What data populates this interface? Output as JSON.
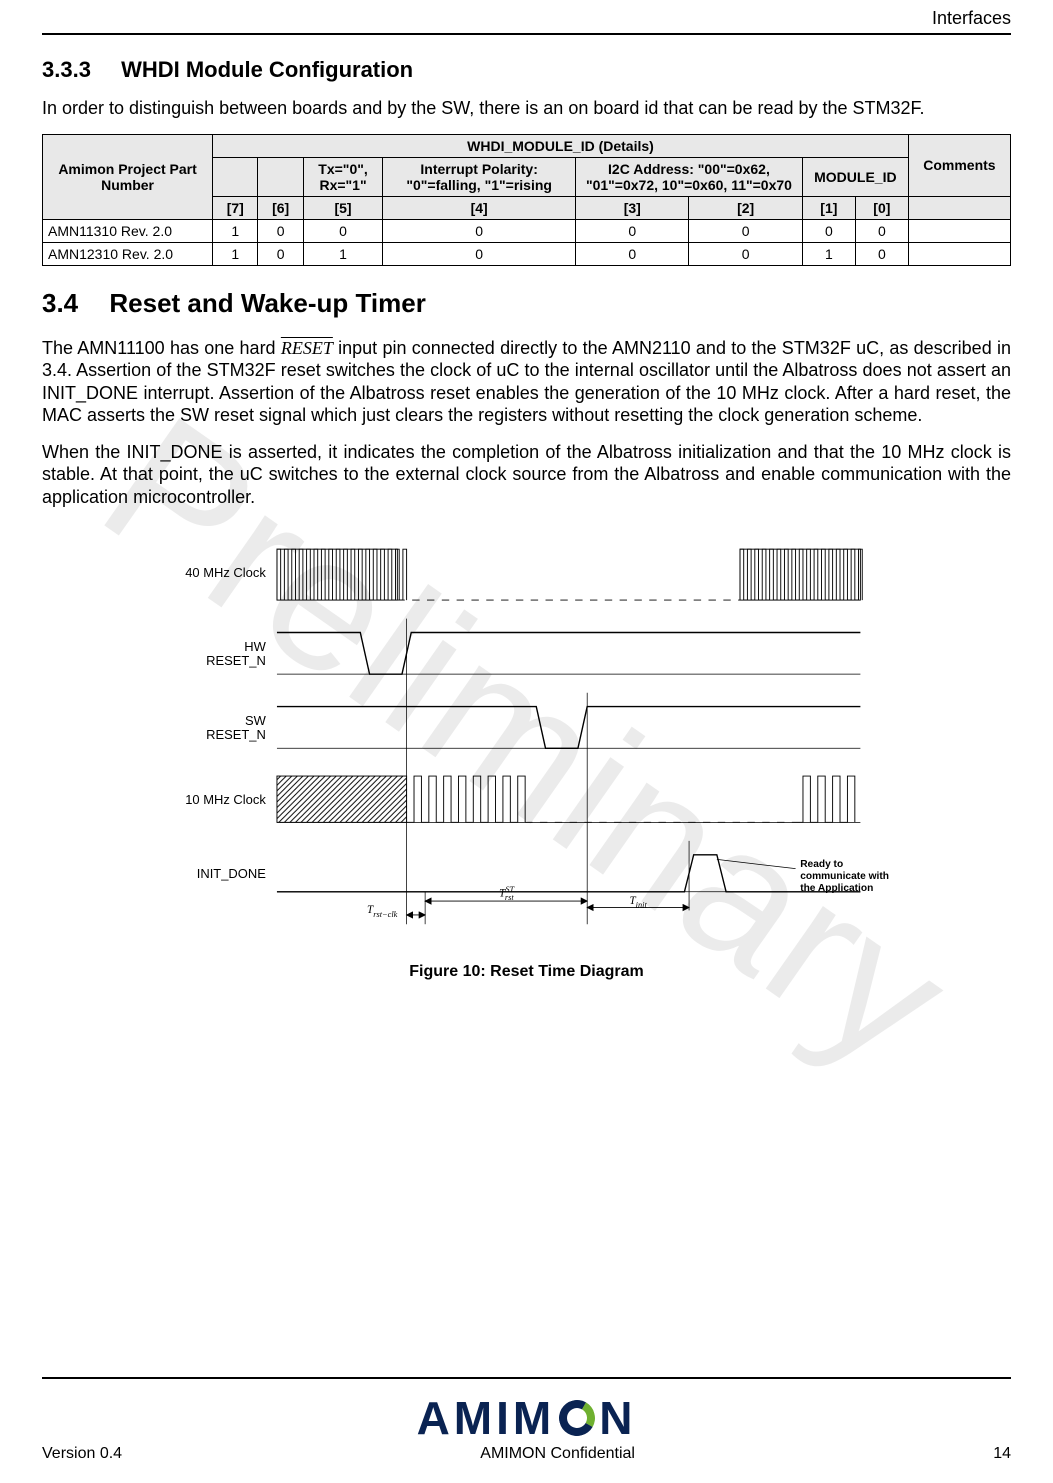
{
  "header": {
    "section": "Interfaces"
  },
  "s333": {
    "num": "3.3.3",
    "title": "WHDI Module Configuration",
    "intro": "In order to distinguish between boards and by the SW, there is an on board id that can be read by the STM32F."
  },
  "table": {
    "col0": "Amimon Project Part Number",
    "groupHeader": "WHDI_MODULE_ID (Details)",
    "colComments": "Comments",
    "hdr_blank1": "",
    "hdr_blank2": "",
    "hdr_txrx": "Tx=\"0\", Rx=\"1\"",
    "hdr_intpol": "Interrupt Polarity: \"0\"=falling, \"1\"=rising",
    "hdr_i2c": "I2C Address: \"00\"=0x62, \"01\"=0x72, 10\"=0x60, 11\"=0x70",
    "hdr_modid": "MODULE_ID",
    "bits": [
      "[7]",
      "[6]",
      "[5]",
      "[4]",
      "[3]",
      "[2]",
      "[1]",
      "[0]"
    ],
    "rows": [
      {
        "pn": "AMN11310 Rev. 2.0",
        "b": [
          "1",
          "0",
          "0",
          "0",
          "0",
          "0",
          "0",
          "0"
        ],
        "c": ""
      },
      {
        "pn": "AMN12310 Rev. 2.0",
        "b": [
          "1",
          "0",
          "1",
          "0",
          "0",
          "0",
          "1",
          "0"
        ],
        "c": ""
      }
    ]
  },
  "s34": {
    "num": "3.4",
    "title": "Reset and Wake-up Timer",
    "p1a": "The AMN11100 has one hard ",
    "reset": "RESET",
    "p1b": " input pin connected directly to the AMN2110 and to the STM32F uC, as described in 3.4. Assertion of the STM32F reset switches the clock of uC to the internal oscillator until the Albatross does not assert an INIT_DONE interrupt. Assertion of the Albatross reset enables the generation of the 10 MHz clock. After a hard reset, the MAC asserts the SW reset signal which just clears the registers without resetting the clock generation scheme.",
    "p2": "When the INIT_DONE is asserted, it indicates the completion of the Albatross initialization and that the 10 MHz clock is stable. At that point, the uC switches to the external clock source from the Albatross and enable communication with the application microcontroller."
  },
  "figure": {
    "labels": {
      "clk40": "40 MHz Clock",
      "hwrst": "HW RESET_N",
      "swrst": "SW RESET_N",
      "clk10": "10 MHz Clock",
      "initdone": "INIT_DONE",
      "trstclk": "T",
      "trstclk_sub": "rst−clk",
      "trstST": "T",
      "trstST_sup": "ST",
      "trstST_sub": "rst",
      "tinit": "T",
      "tinit_sub": "init",
      "ready": "Ready to communicate with the Application"
    },
    "caption": "Figure 10: Reset Time Diagram"
  },
  "footer": {
    "version": "Version 0.4",
    "confidential": "AMIMON Confidential",
    "page": "14",
    "logo_text_left": "AMIM",
    "logo_text_right": "N"
  },
  "watermark": "Preliminary"
}
